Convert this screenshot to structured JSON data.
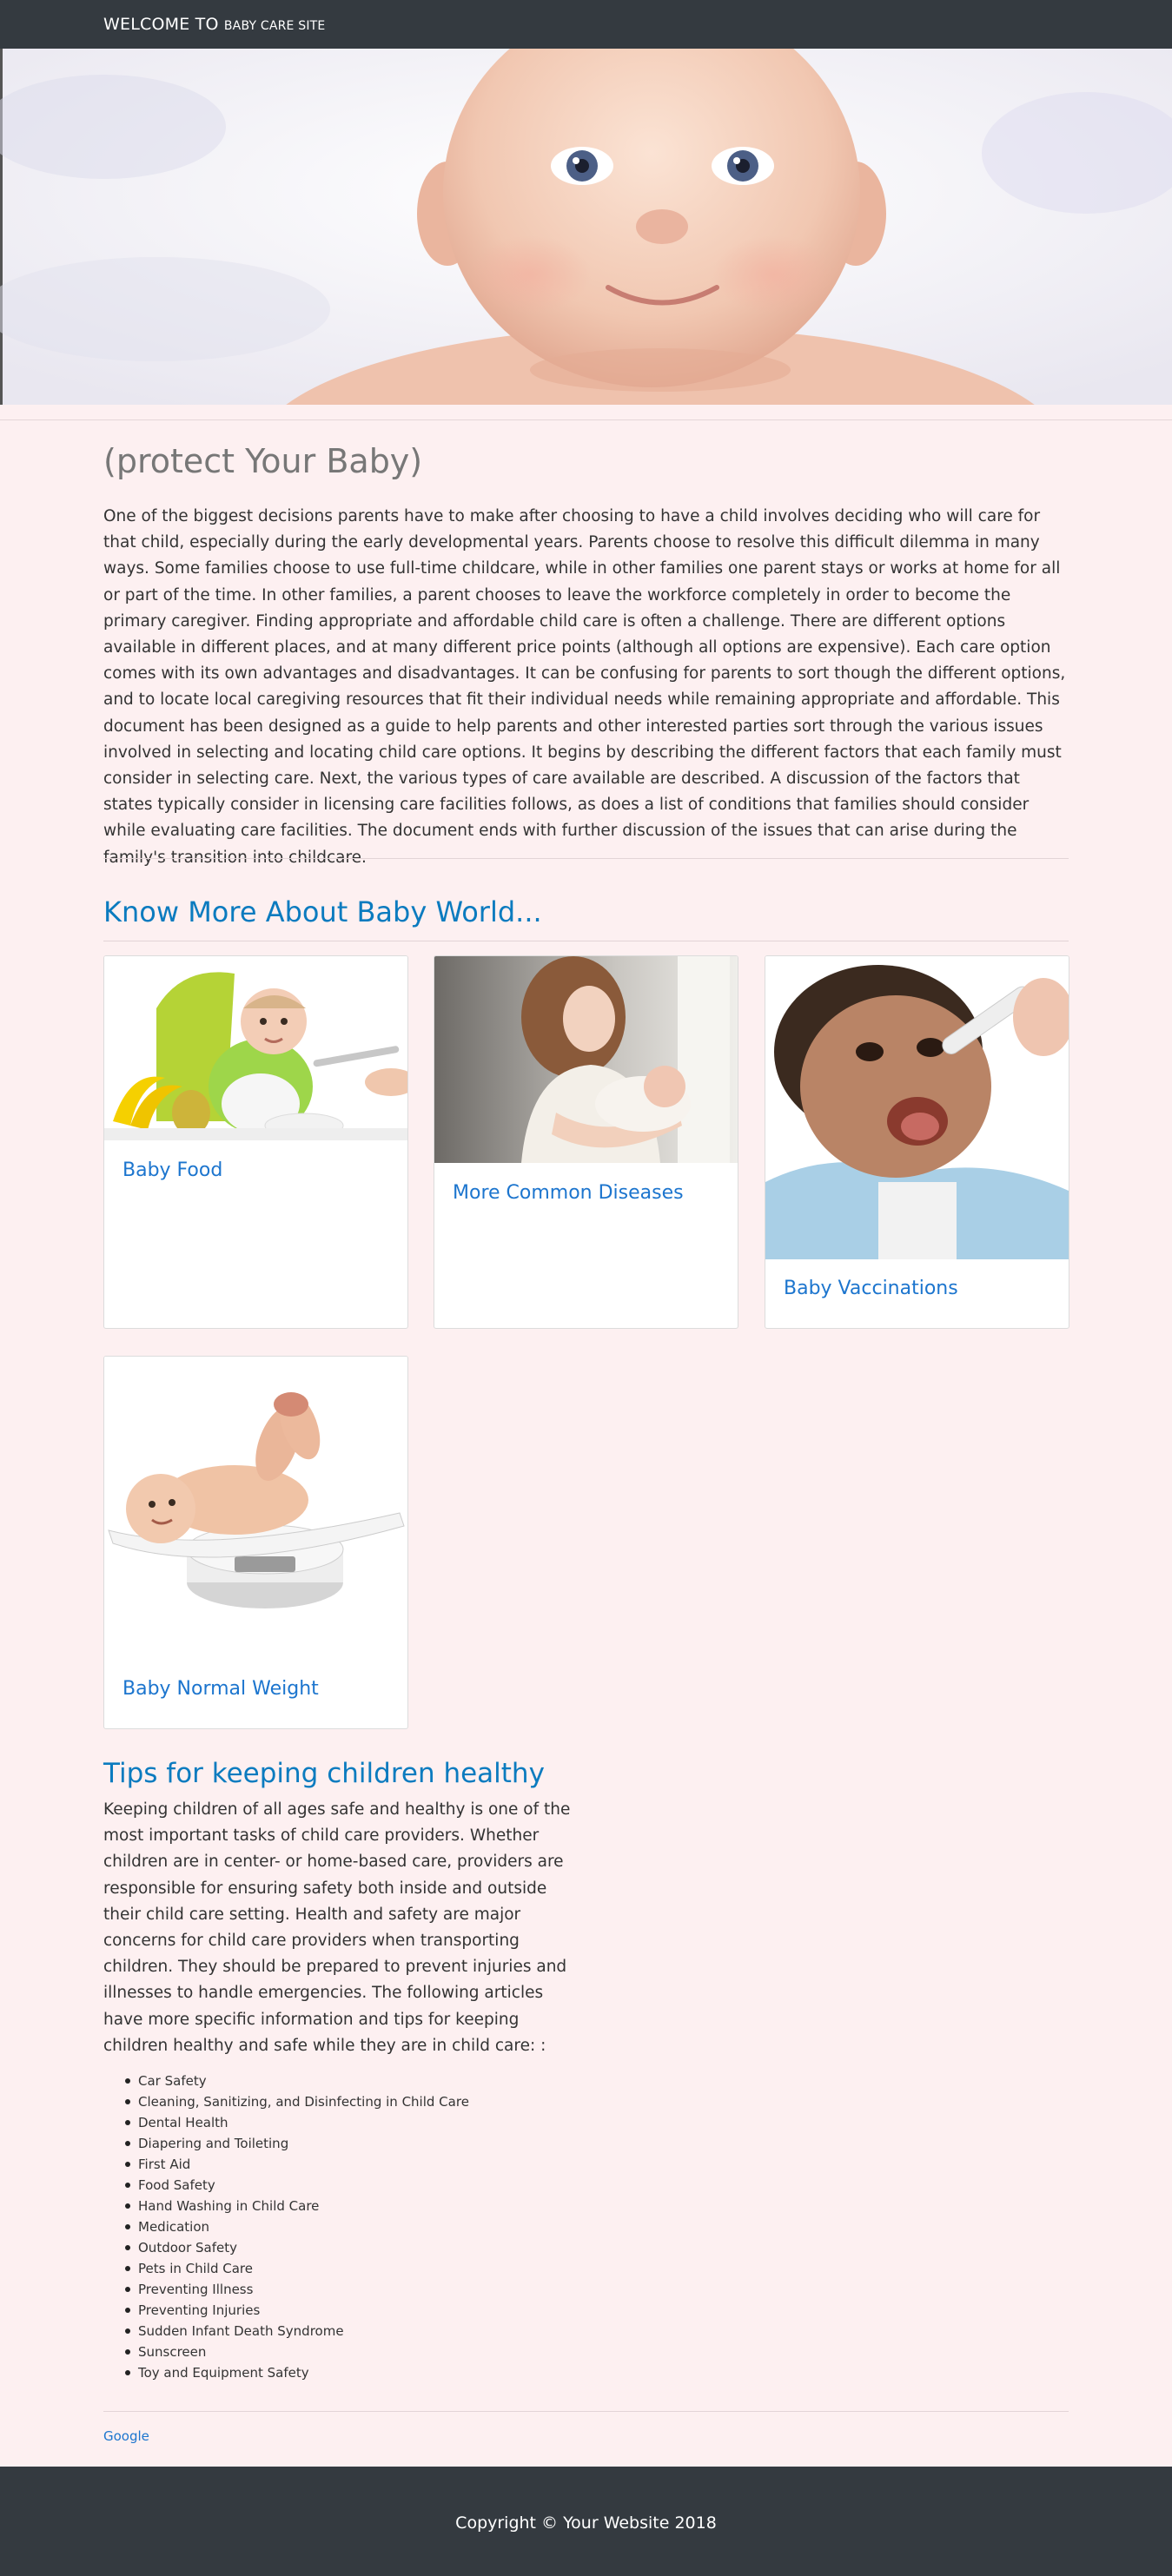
{
  "navbar": {
    "brand_main": "WELCOME TO",
    "brand_small": "BABY CARE SITE"
  },
  "hero": {
    "image_alt": "smiling baby banner photo"
  },
  "main": {
    "title": "(protect Your Baby)",
    "intro": "One of the biggest decisions parents have to make after choosing to have a child involves deciding who will care for that child, especially during the early developmental years. Parents choose to resolve this difficult dilemma in many ways. Some families choose to use full-time childcare, while in other families one parent stays or works at home for all or part of the time. In other families, a parent chooses to leave the workforce completely in order to become the primary caregiver. Finding appropriate and affordable child care is often a challenge. There are different options available in different places, and at many different price points (although all options are expensive). Each care option comes with its own advantages and disadvantages. It can be confusing for parents to sort though the different options, and to locate local caregiving resources that fit their individual needs while remaining appropriate and affordable. This document has been designed as a guide to help parents and other interested parties sort through the various issues involved in selecting and locating child care options. It begins by describing the different factors that each family must consider in selecting care. Next, the various types of care available are described. A discussion of the factors that states typically consider in licensing care facilities follows, as does a list of conditions that families should consider while evaluating care facilities. The document ends with further discussion of the issues that can arise during the family's transition into childcare."
  },
  "know_more": {
    "title": "Know More About Baby World...",
    "cards": [
      {
        "title": "Baby Food",
        "image": "baby eating food photo"
      },
      {
        "title": "More Common Diseases",
        "image": "mother holding baby photo"
      },
      {
        "title": "Baby Vaccinations",
        "image": "baby oral vaccination photo"
      },
      {
        "title": "Baby Normal Weight",
        "image": "baby on weighing scale photo"
      }
    ]
  },
  "tips": {
    "title": "Tips for keeping children healthy",
    "text": "Keeping children of all ages safe and healthy is one of the most important tasks of child care providers. Whether children are in center- or home-based care, providers are responsible for ensuring safety both inside and outside their child care setting. Health and safety are major concerns for child care providers when transporting children. They should be prepared to prevent injuries and illnesses to handle emergencies. The following articles have more specific information and tips for keeping children healthy and safe while they are in child care: :",
    "items": [
      "Car Safety",
      "Cleaning, Sanitizing, and Disinfecting in Child Care",
      "Dental Health",
      "Diapering and Toileting",
      "First Aid",
      "Food Safety",
      "Hand Washing in Child Care",
      "Medication",
      "Outdoor Safety",
      "Pets in Child Care",
      "Preventing Illness",
      "Preventing Injuries",
      "Sudden Infant Death Syndrome",
      "Sunscreen",
      "Toy and Equipment Safety"
    ]
  },
  "links": {
    "google": "Google"
  },
  "footer": {
    "copyright": "Copyright © Your Website 2018"
  },
  "colors": {
    "navbar_bg": "#343a40",
    "page_bg": "#fdf0f1",
    "heading_blue": "#0b7bbf",
    "link_blue": "#1c75ce"
  }
}
